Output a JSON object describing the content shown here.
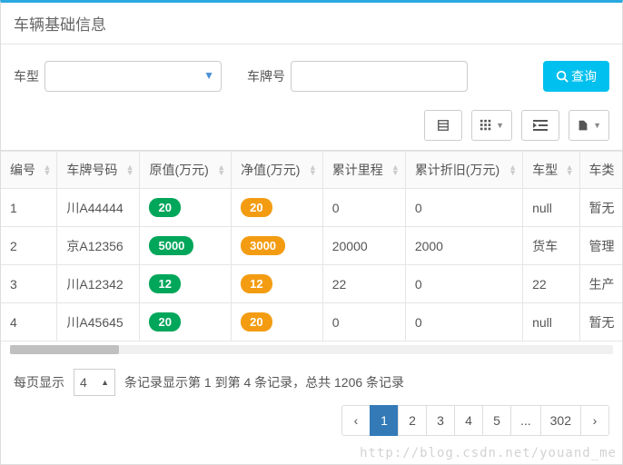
{
  "header": {
    "title": "车辆基础信息"
  },
  "search": {
    "type_label": "车型",
    "plate_label": "车牌号",
    "button_label": "查询"
  },
  "columns": {
    "idx": "编号",
    "plate": "车牌号码",
    "origval": "原值(万元)",
    "netval": "净值(万元)",
    "mileage": "累计里程",
    "depr": "累计折旧(万元)",
    "type": "车型",
    "cat": "车类"
  },
  "rows": [
    {
      "idx": "1",
      "plate": "川A44444",
      "origval": "20",
      "netval": "20",
      "mileage": "0",
      "depr": "0",
      "type": "null",
      "cat": "暂无"
    },
    {
      "idx": "2",
      "plate": "京A12356",
      "origval": "5000",
      "netval": "3000",
      "mileage": "20000",
      "depr": "2000",
      "type": "货车",
      "cat": "管理"
    },
    {
      "idx": "3",
      "plate": "川A12342",
      "origval": "12",
      "netval": "12",
      "mileage": "22",
      "depr": "0",
      "type": "22",
      "cat": "生产"
    },
    {
      "idx": "4",
      "plate": "川A45645",
      "origval": "20",
      "netval": "20",
      "mileage": "0",
      "depr": "0",
      "type": "null",
      "cat": "暂无"
    }
  ],
  "footer": {
    "page_size_label": "每页显示",
    "page_size_value": "4",
    "info_text": "条记录显示第 1 到第 4 条记录，总共 1206 条记录"
  },
  "pagination": {
    "prev": "‹",
    "pages": [
      "1",
      "2",
      "3",
      "4",
      "5",
      "...",
      "302"
    ],
    "active": "1",
    "next": "›"
  },
  "watermark": "http://blog.csdn.net/youand_me"
}
